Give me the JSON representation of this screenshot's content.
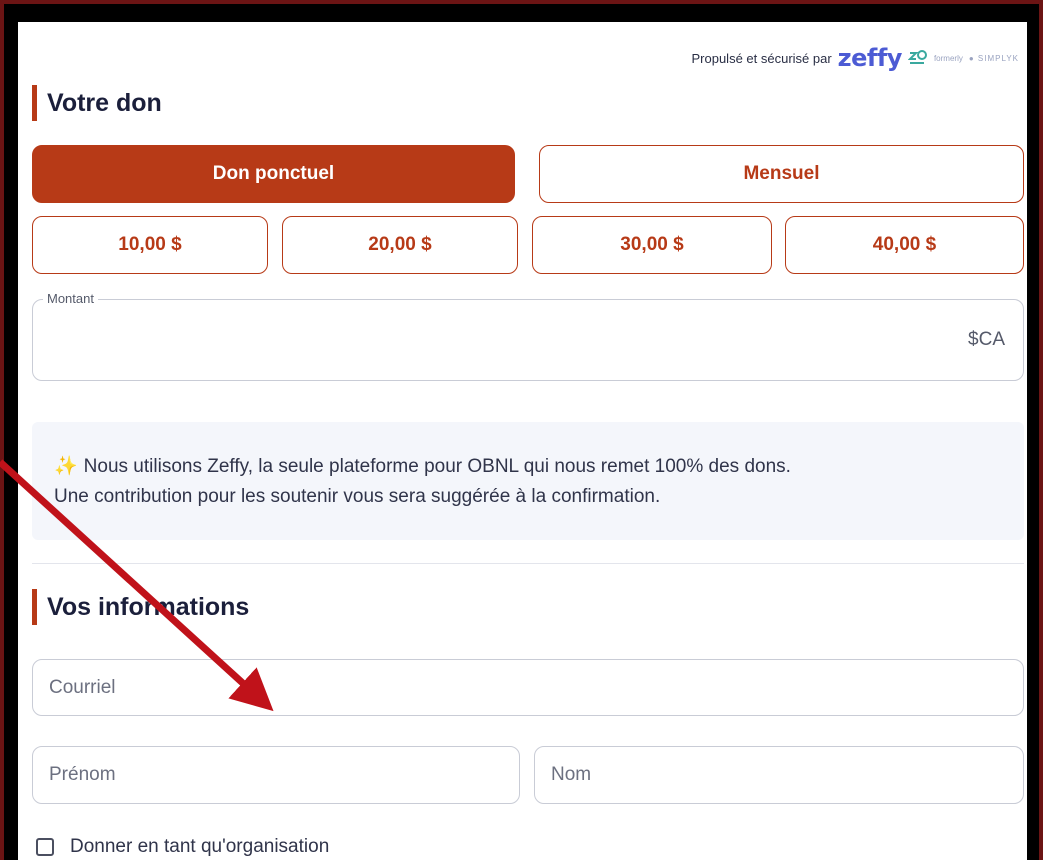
{
  "powered_by": {
    "text": "Propulsé et sécurisé par",
    "brand": "zeffy",
    "formerly": "formerly",
    "former_brand": "SIMPLYK"
  },
  "donation": {
    "title": "Votre don",
    "frequency": [
      {
        "label": "Don ponctuel",
        "selected": true
      },
      {
        "label": "Mensuel",
        "selected": false
      }
    ],
    "amounts": [
      "10,00 $",
      "20,00 $",
      "30,00 $",
      "40,00 $"
    ],
    "amount_field": {
      "label": "Montant",
      "value": "",
      "currency": "$CA"
    }
  },
  "info": {
    "icon": "sparkle-icon",
    "text_line1": "Nous utilisons Zeffy, la seule plateforme pour OBNL qui nous remet 100% des dons.",
    "text_line2": "Une contribution pour les soutenir vous sera suggérée à la confirmation."
  },
  "personal": {
    "title": "Vos informations",
    "email_placeholder": "Courriel",
    "first_name_placeholder": "Prénom",
    "last_name_placeholder": "Nom",
    "organization_checkbox": {
      "label": "Donner en tant qu'organisation",
      "checked": false
    }
  },
  "colors": {
    "accent": "#b73a17",
    "brand": "#4c5bd4",
    "annotation_arrow": "#c0121a",
    "frame": "#6b1414"
  }
}
